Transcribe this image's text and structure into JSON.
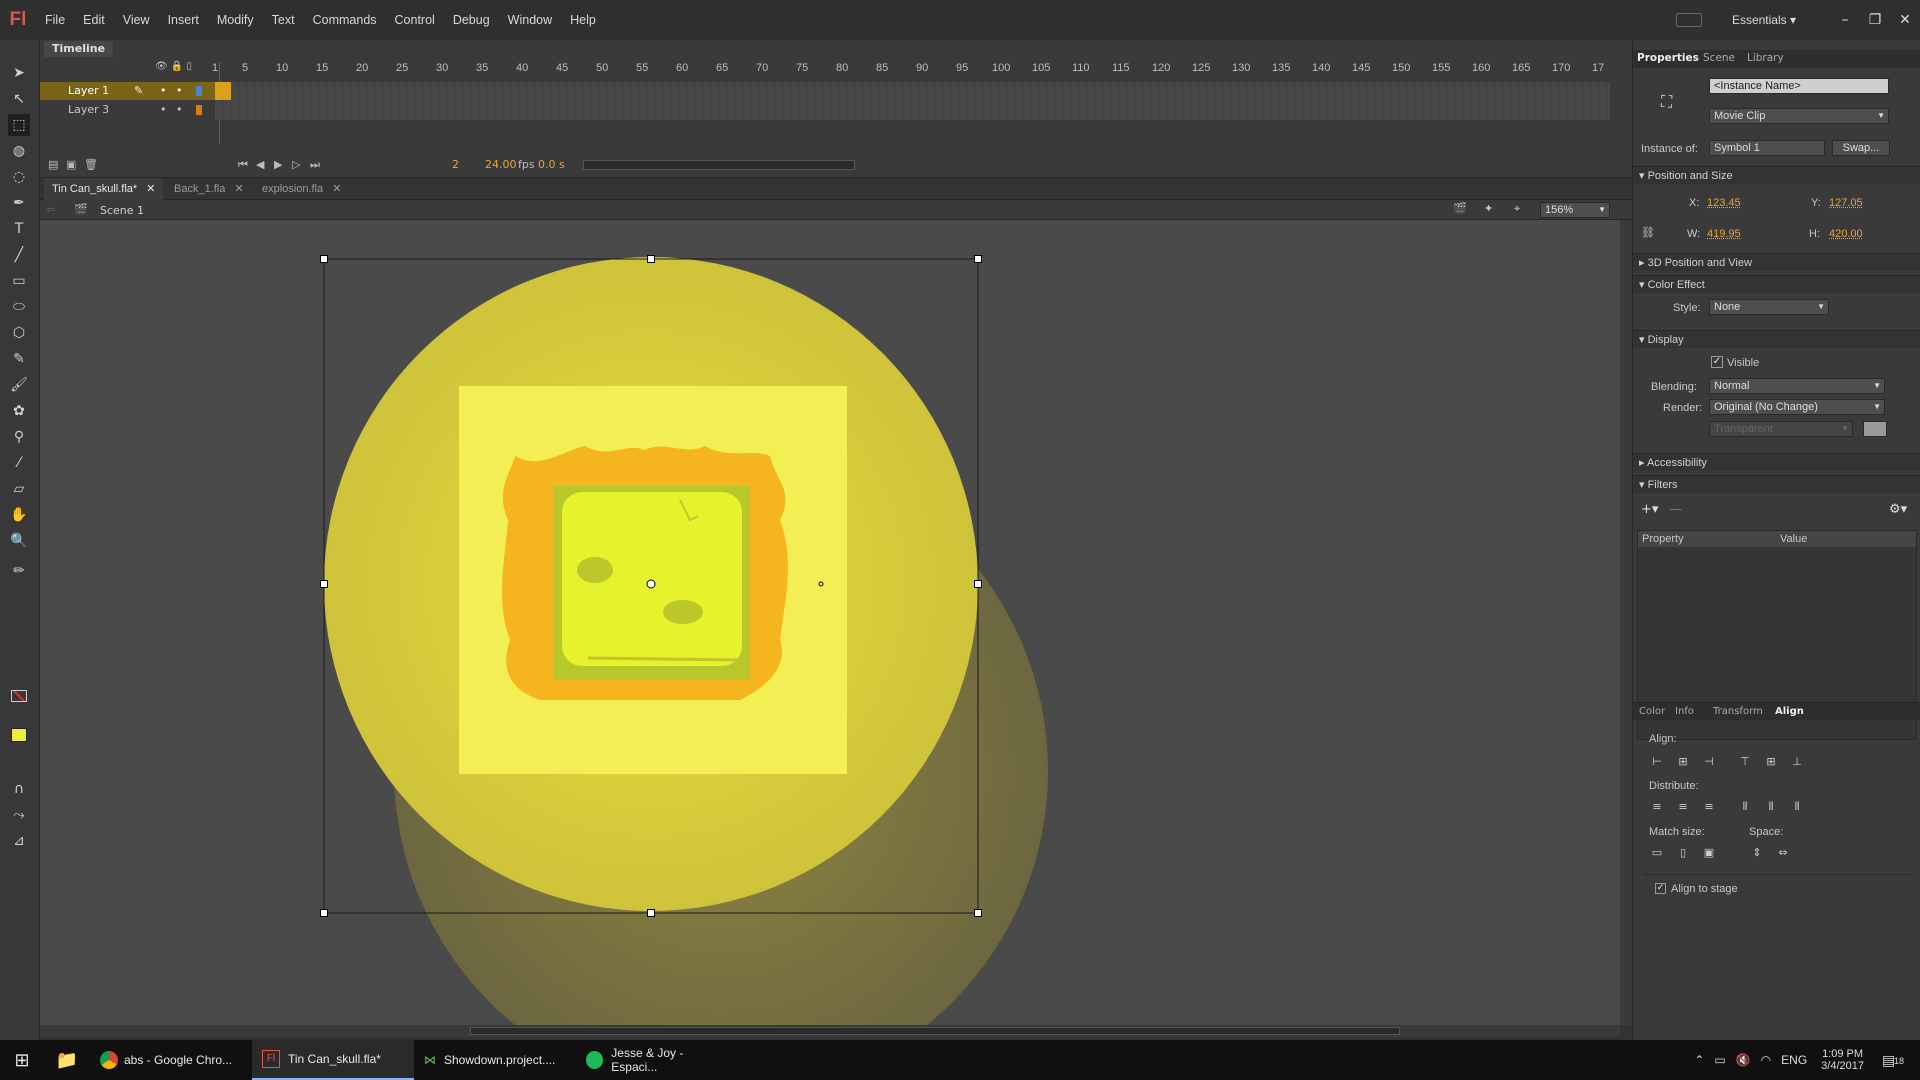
{
  "app": {
    "logo": "Fl"
  },
  "menu": [
    "File",
    "Edit",
    "View",
    "Insert",
    "Modify",
    "Text",
    "Commands",
    "Control",
    "Debug",
    "Window",
    "Help"
  ],
  "workspace": {
    "label": "Essentials"
  },
  "timeline": {
    "tab_label": "Timeline",
    "ruler": [
      "1",
      "5",
      "10",
      "15",
      "20",
      "25",
      "30",
      "35",
      "40",
      "45",
      "50",
      "55",
      "60",
      "65",
      "70",
      "75",
      "80",
      "85",
      "90",
      "95",
      "100",
      "105",
      "110",
      "115",
      "120",
      "125",
      "130",
      "135",
      "140",
      "145",
      "150",
      "155",
      "160",
      "165",
      "170",
      "17"
    ],
    "layers": [
      {
        "name": "Layer 1",
        "color": "#4f7fd6"
      },
      {
        "name": "Layer 3",
        "color": "#e07b16"
      }
    ],
    "frame": "2",
    "fps": "24.00",
    "fps_unit": "fps",
    "time": "0.0 s"
  },
  "doc_tabs": [
    "Tin Can_skull.fla*",
    "Back_1.fla",
    "explosion.fla"
  ],
  "scene": {
    "label": "Scene 1",
    "zoom": "156%"
  },
  "properties": {
    "tabs": [
      "Properties",
      "Scene",
      "Library"
    ],
    "instance_name_placeholder": "<Instance Name>",
    "instance_type": "Movie Clip",
    "instance_of_label": "Instance of:",
    "instance_of_value": "Symbol 1",
    "swap_label": "Swap...",
    "position_section": "Position and Size",
    "x_label": "X:",
    "x_value": "123.45",
    "y_label": "Y:",
    "y_value": "127.05",
    "w_label": "W:",
    "w_value": "419.95",
    "h_label": "H:",
    "h_value": "420.00",
    "section_3d": "3D Position and View",
    "color_effect_section": "Color Effect",
    "style_label": "Style:",
    "style_value": "None",
    "display_section": "Display",
    "visible_label": "Visible",
    "blending_label": "Blending:",
    "blending_value": "Normal",
    "render_label": "Render:",
    "render_value": "Original (No Change)",
    "transparent_value": "Transparent",
    "accessibility_section": "Accessibility",
    "filters_section": "Filters",
    "filter_col_property": "Property",
    "filter_col_value": "Value"
  },
  "align_panel": {
    "tabs": [
      "Color",
      "Info",
      "Transform",
      "Align"
    ],
    "align_label": "Align:",
    "distribute_label": "Distribute:",
    "match_size_label": "Match size:",
    "space_label": "Space:",
    "align_to_stage_label": "Align to stage"
  },
  "taskbar": {
    "items": [
      {
        "label": "abs - Google Chro...",
        "icon": "chrome-icon"
      },
      {
        "label": "Tin Can_skull.fla*",
        "icon": "flash-icon"
      },
      {
        "label": "Showdown.project....",
        "icon": "app-icon"
      },
      {
        "label": "Jesse & Joy - Espaci...",
        "icon": "spotify-icon"
      }
    ],
    "lang": "ENG",
    "time": "1:09 PM",
    "date": "3/4/2017",
    "notif_count": "18"
  },
  "colors": {
    "accent": "#e8a531",
    "stage_bg": "#4a4a4a",
    "circle": "#e6d83c",
    "fill": "#f5f044"
  }
}
